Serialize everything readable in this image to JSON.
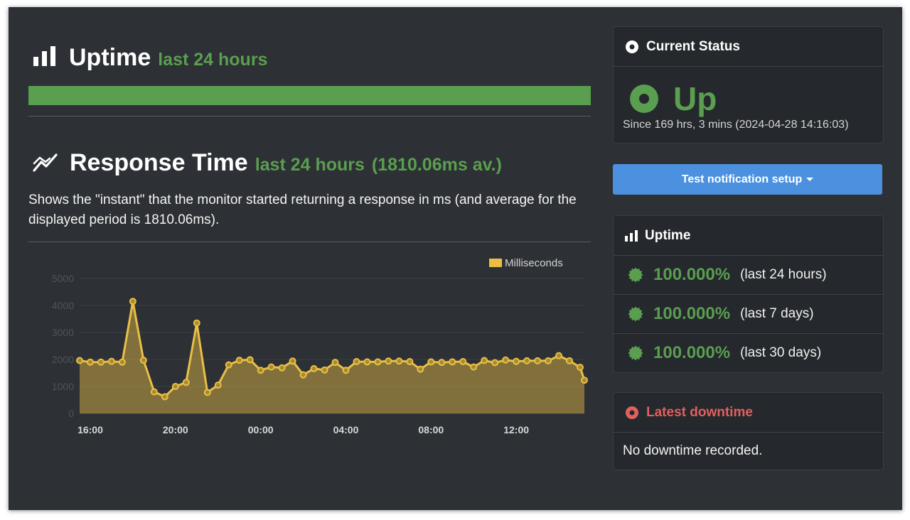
{
  "uptime": {
    "title": "Uptime",
    "period": "last 24 hours",
    "bar_percent": 100
  },
  "response": {
    "title": "Response Time",
    "period": "last 24 hours",
    "average": "(1810.06ms av.)",
    "description": "Shows the \"instant\" that the monitor started returning a response in ms (and average for the displayed period is 1810.06ms)."
  },
  "chart_data": {
    "type": "area",
    "legend": "Milliseconds",
    "legend_position": "top-right",
    "ylim": [
      0,
      5000
    ],
    "y_ticks": [
      0,
      1000,
      2000,
      3000,
      4000,
      5000
    ],
    "x_ticks": [
      "16:00",
      "20:00",
      "00:00",
      "04:00",
      "08:00",
      "12:00"
    ],
    "x_tick_hours": [
      1,
      5,
      9,
      13,
      17,
      21
    ],
    "x_range_hours": [
      0.5,
      24.2
    ],
    "grid": true,
    "series": [
      {
        "name": "Milliseconds",
        "x": [
          0.5,
          1.0,
          1.5,
          2.0,
          2.5,
          3.0,
          3.5,
          4.0,
          4.5,
          5.0,
          5.5,
          6.0,
          6.5,
          7.0,
          7.5,
          8.0,
          8.5,
          9.0,
          9.5,
          10.0,
          10.5,
          11.0,
          11.5,
          12.0,
          12.5,
          13.0,
          13.5,
          14.0,
          14.5,
          15.0,
          15.5,
          16.0,
          16.5,
          17.0,
          17.5,
          18.0,
          18.5,
          19.0,
          19.5,
          20.0,
          20.5,
          21.0,
          21.5,
          22.0,
          22.5,
          23.0,
          23.5,
          24.0,
          24.2
        ],
        "values": [
          1960,
          1900,
          1900,
          1930,
          1900,
          4150,
          1970,
          800,
          620,
          1000,
          1150,
          3350,
          780,
          1050,
          1800,
          1970,
          1990,
          1600,
          1720,
          1690,
          1940,
          1430,
          1660,
          1610,
          1890,
          1600,
          1920,
          1910,
          1910,
          1940,
          1940,
          1920,
          1640,
          1910,
          1890,
          1910,
          1920,
          1720,
          1960,
          1880,
          1980,
          1930,
          1950,
          1950,
          1950,
          2140,
          1950,
          1710,
          1230
        ]
      }
    ]
  },
  "status": {
    "header": "Current Status",
    "state": "Up",
    "since": "Since 169 hrs, 3 mins (2024-04-28 14:16:03)"
  },
  "notify_button": "Test notification setup",
  "uptime_panel": {
    "header": "Uptime",
    "items": [
      {
        "percent": "100.000%",
        "period": "(last 24 hours)"
      },
      {
        "percent": "100.000%",
        "period": "(last 7 days)"
      },
      {
        "percent": "100.000%",
        "period": "(last 30 days)"
      }
    ]
  },
  "downtime": {
    "header": "Latest downtime",
    "message": "No downtime recorded."
  },
  "colors": {
    "green": "#5a9e50",
    "red": "#e0605f",
    "line": "#e9bf45",
    "button": "#4b91e0"
  }
}
